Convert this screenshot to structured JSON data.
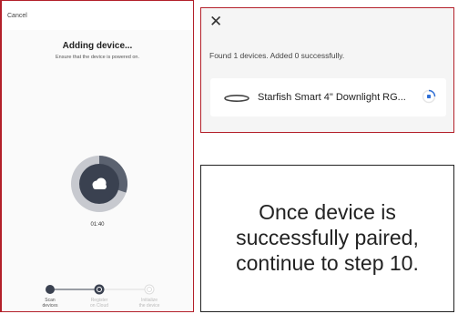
{
  "phone": {
    "cancel_label": "Cancel",
    "title": "Adding device...",
    "subtitle": "Ensure that the device is powered on.",
    "timer": "01:40",
    "progress_fraction": 0.3,
    "steps": [
      {
        "label_line1": "Scan",
        "label_line2": "devices",
        "state": "done"
      },
      {
        "label_line1": "Register",
        "label_line2": "on Cloud",
        "state": "active"
      },
      {
        "label_line1": "Initialize",
        "label_line2": "the device",
        "state": "pending"
      }
    ]
  },
  "dialog": {
    "close_icon": "close-icon",
    "status": "Found 1 devices. Added 0 successfully.",
    "device_name": "Starfish Smart 4\" Downlight RG..."
  },
  "note": {
    "line1": "Once device is",
    "line2": "successfully paired,",
    "line3": "continue to step 10."
  },
  "colors": {
    "frame_red": "#b3202a",
    "accent_blue": "#2f6fd6",
    "ring_dark": "#3a4150",
    "ring_light": "#c7c9cf"
  }
}
